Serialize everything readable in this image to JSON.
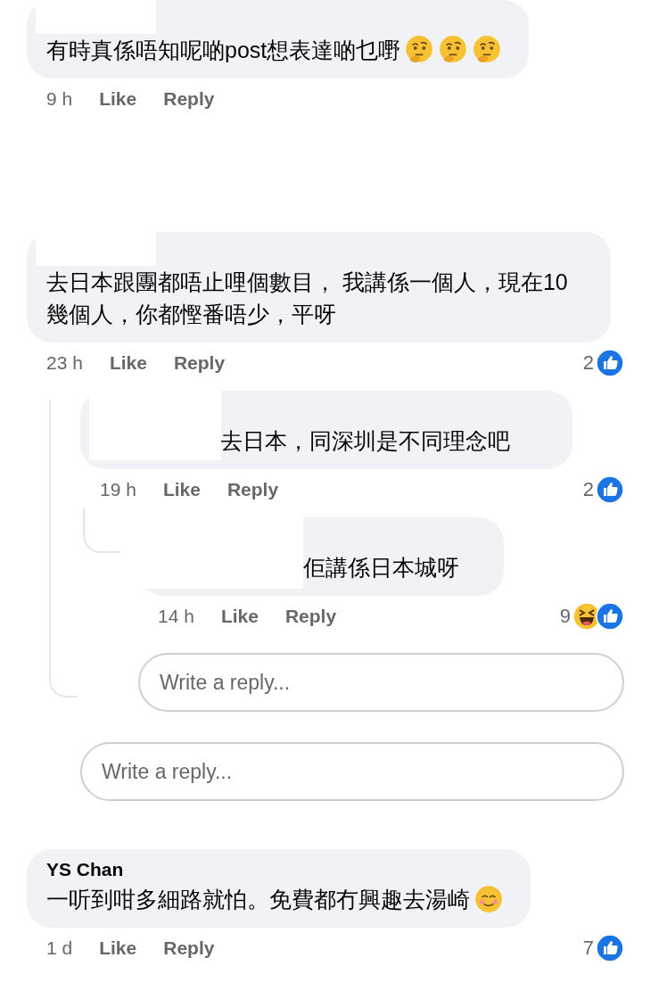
{
  "comments": [
    {
      "author_hidden": true,
      "text": "有時真係唔知呢啲post想表達啲乜嘢",
      "emoji": [
        {
          "kind": "thinking"
        },
        {
          "kind": "thinking"
        },
        {
          "kind": "thinking"
        }
      ],
      "time": "9 h",
      "like": "Like",
      "reply": "Reply"
    },
    {
      "author_hidden": true,
      "text": "去日本跟團都唔止哩個數目， 我講係一個人，現在10幾個人，你都慳番唔少，平呀",
      "time": "23 h",
      "like": "Like",
      "reply": "Reply",
      "reaction_count": "2",
      "reactions": [
        {
          "kind": "like"
        }
      ],
      "replies": [
        {
          "author_hidden": true,
          "text": "去日本，同深圳是不同理念吧",
          "time": "19 h",
          "like": "Like",
          "reply": "Reply",
          "reaction_count": "2",
          "reactions": [
            {
              "kind": "like"
            }
          ],
          "replies": [
            {
              "author_hidden": true,
              "text": "佢講係日本城呀",
              "time": "14 h",
              "like": "Like",
              "reply": "Reply",
              "reaction_count": "9",
              "reactions": [
                {
                  "kind": "haha"
                },
                {
                  "kind": "like"
                }
              ]
            }
          ],
          "reply_field": {
            "placeholder": "Write a reply..."
          }
        }
      ],
      "reply_field": {
        "placeholder": "Write a reply..."
      }
    },
    {
      "author_hidden": false,
      "author": "YS Chan",
      "text": "一听到咁多細路就怕。免費都冇興趣去湯崎",
      "emoji": [
        {
          "kind": "smiling"
        }
      ],
      "time": "1 d",
      "like": "Like",
      "reply": "Reply",
      "reaction_count": "7",
      "reactions": [
        {
          "kind": "like"
        }
      ]
    }
  ]
}
